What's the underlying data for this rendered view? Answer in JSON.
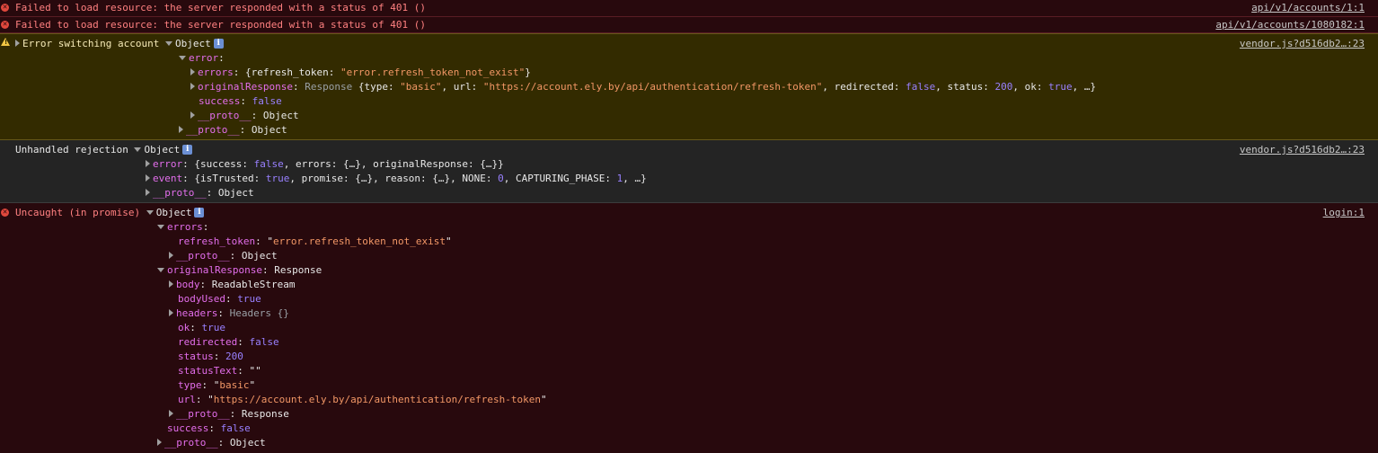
{
  "console": {
    "messages": [
      {
        "text": "Failed to load resource: the server responded with a status of 401 ()",
        "source": "api/v1/accounts/1:1"
      },
      {
        "text": "Failed to load resource: the server responded with a status of 401 ()",
        "source": "api/v1/accounts/1080182:1"
      }
    ],
    "warn": {
      "label": "Error switching account",
      "object": "Object",
      "source": "vendor.js?d516db2…:23",
      "error_key": "error",
      "errors_key": "errors",
      "errors_preview_open": "{refresh_token: ",
      "errors_preview_value": "\"error.refresh_token_not_exist\"",
      "errors_preview_close": "}",
      "original_key": "originalResponse",
      "original_type": "Response",
      "original_p1": " {type: ",
      "original_type_val": "\"basic\"",
      "original_p2": ", url: ",
      "original_url_val": "\"https://account.ely.by/api/authentication/refresh-token\"",
      "original_p3": ", redirected: ",
      "original_redirected_val": "false",
      "original_p4": ", status: ",
      "original_status_val": "200",
      "original_p5": ", ok: ",
      "original_ok_val": "true",
      "original_p6": ", …}",
      "success_key": "success",
      "success_val": "false",
      "proto_key": "__proto__",
      "proto_val": "Object"
    },
    "rejection": {
      "label": "Unhandled rejection",
      "object": "Object",
      "source": "vendor.js?d516db2…:23",
      "error_key": "error",
      "error_p1": "{success: ",
      "error_success_val": "false",
      "error_p2": ", errors: {…}, originalResponse: {…}}",
      "event_key": "event",
      "event_p1": "{isTrusted: ",
      "event_trusted_val": "true",
      "event_p2": ", promise: {…}, reason: {…}, NONE: ",
      "event_none_val": "0",
      "event_p3": ", CAPTURING_PHASE: ",
      "event_capt_val": "1",
      "event_p4": ", …}",
      "proto_key": "__proto__",
      "proto_val": "Object"
    },
    "uncaught": {
      "label": "Uncaught (in promise)",
      "object": "Object",
      "source": "login:1",
      "errors_key": "errors",
      "refresh_key": "refresh_token",
      "refresh_val": "error.refresh_token_not_exist",
      "proto_key": "__proto__",
      "proto_object": "Object",
      "original_key": "originalResponse",
      "original_type": "Response",
      "body_key": "body",
      "body_val": "ReadableStream",
      "bodyused_key": "bodyUsed",
      "bodyused_val": "true",
      "headers_key": "headers",
      "headers_val": "Headers {}",
      "ok_key": "ok",
      "ok_val": "true",
      "redirected_key": "redirected",
      "redirected_val": "false",
      "status_key": "status",
      "status_val": "200",
      "statustext_key": "statusText",
      "statustext_val": "\"\"",
      "type_key": "type",
      "type_val": "basic",
      "url_key": "url",
      "url_val": "https://account.ely.by/api/authentication/refresh-token",
      "proto_response": "Response",
      "success_key": "success",
      "success_val": "false"
    }
  }
}
